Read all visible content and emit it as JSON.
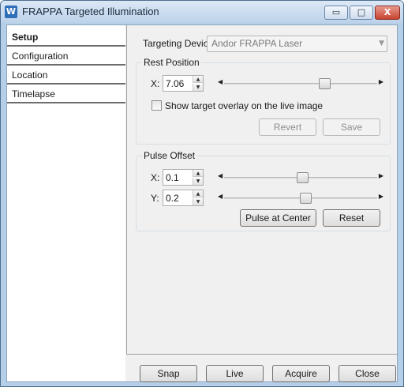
{
  "window": {
    "title": "FRAPPA Targeted Illumination",
    "min_glyph": "▭",
    "max_glyph": "□",
    "close_glyph": "X"
  },
  "sidebar": {
    "items": [
      {
        "label": "Setup",
        "active": true
      },
      {
        "label": "Configuration",
        "active": false
      },
      {
        "label": "Location",
        "active": false
      },
      {
        "label": "Timelapse",
        "active": false
      }
    ]
  },
  "setup": {
    "device_label": "Targeting Device:",
    "device_value": "Andor FRAPPA Laser",
    "rest": {
      "title": "Rest Position",
      "x_label": "X:",
      "x_value": "7.06",
      "x_slider_level": 0.66,
      "overlay_label": "Show target overlay on the live image",
      "overlay_checked": false,
      "revert_label": "Revert",
      "save_label": "Save"
    },
    "pulse": {
      "title": "Pulse Offset",
      "x_label": "X:",
      "x_value": "0.1",
      "x_slider_level": 0.51,
      "y_label": "Y:",
      "y_value": "0.2",
      "y_slider_level": 0.53,
      "center_label": "Pulse at Center",
      "reset_label": "Reset"
    }
  },
  "footer": {
    "snap_label": "Snap",
    "live_label": "Live",
    "acquire_label": "Acquire",
    "close_label": "Close"
  },
  "glyphs": {
    "spin_up": "▲",
    "spin_down": "▼",
    "arrow_left": "◀",
    "arrow_right": "▶",
    "combo_arrow": "▼",
    "app_icon": "W"
  }
}
